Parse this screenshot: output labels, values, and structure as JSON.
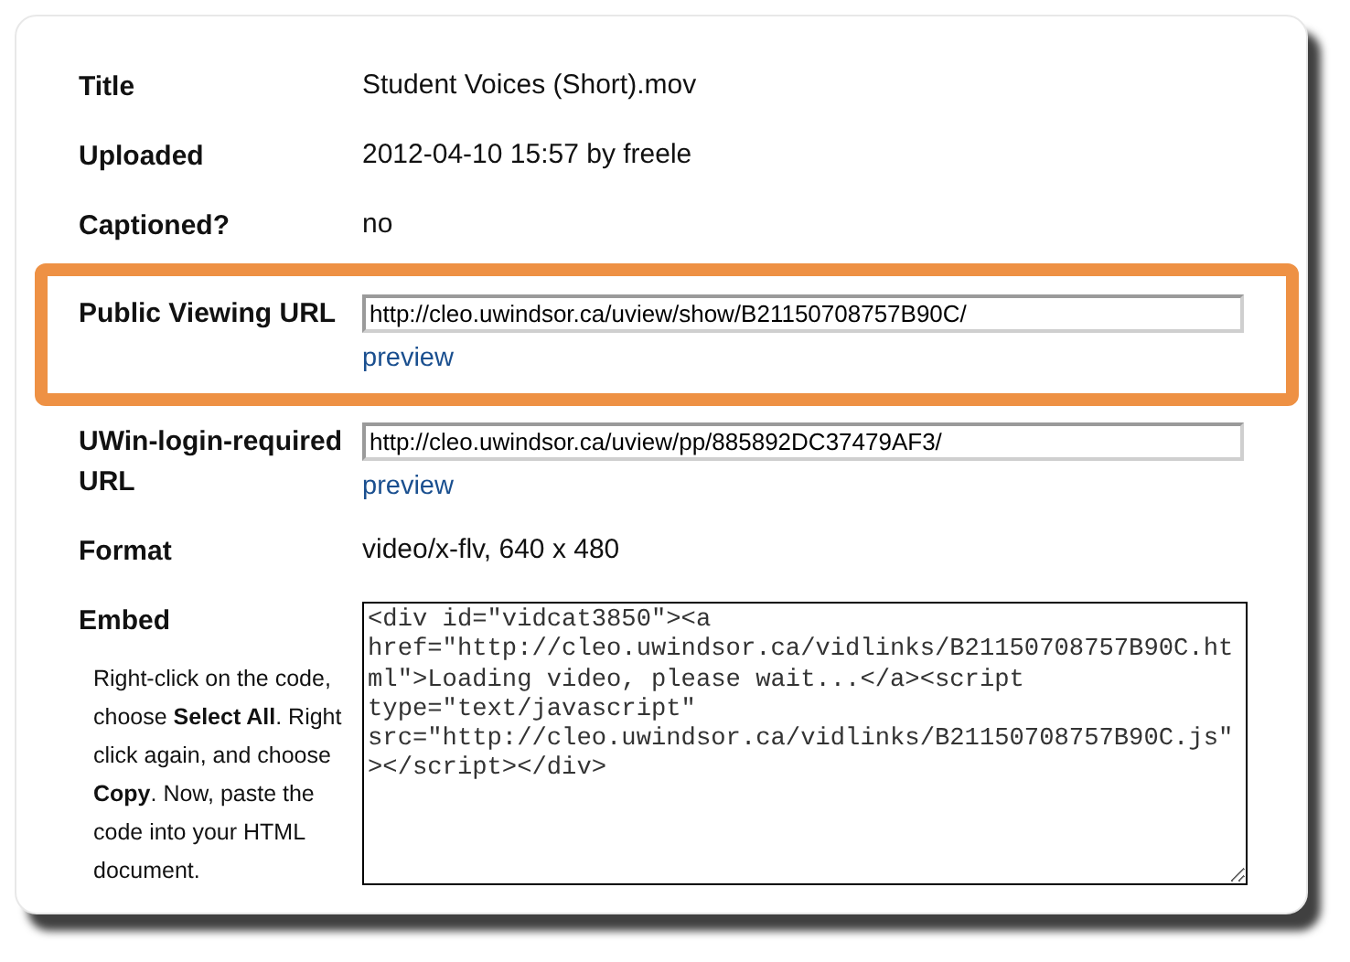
{
  "fields": [
    {
      "kind": "text",
      "label": "Title",
      "value": "Student Voices (Short).mov",
      "highlighted": false
    },
    {
      "kind": "text",
      "label": "Uploaded",
      "value": "2012-04-10 15:57 by freele",
      "highlighted": false
    },
    {
      "kind": "text",
      "label": "Captioned?",
      "value": "no",
      "highlighted": false
    },
    {
      "kind": "url",
      "label": "Public Viewing URL",
      "value": "http://cleo.uwindsor.ca/uview/show/B21150708757B90C/",
      "link": "preview",
      "highlighted": true
    },
    {
      "kind": "url",
      "label": "UWin-login-required URL",
      "value": "http://cleo.uwindsor.ca/uview/pp/885892DC37479AF3/",
      "link": "preview",
      "highlighted": false
    },
    {
      "kind": "text",
      "label": "Format",
      "value": "video/x-flv, 640 x 480",
      "highlighted": false
    },
    {
      "kind": "code",
      "label": "Embed",
      "note": "Right-click on the code, choose **Select All**. Right click again, and choose **Copy**. Now, paste the code into your HTML document.",
      "value": "<div id=\"vidcat3850\"><a href=\"http://cleo.uwindsor.ca/vidlinks/B21150708757B90C.html\">Loading video, please wait...</a><script type=\"text/javascript\" src=\"http://cleo.uwindsor.ca/vidlinks/B21150708757B90C.js\"></script></div>",
      "highlighted": false
    }
  ]
}
